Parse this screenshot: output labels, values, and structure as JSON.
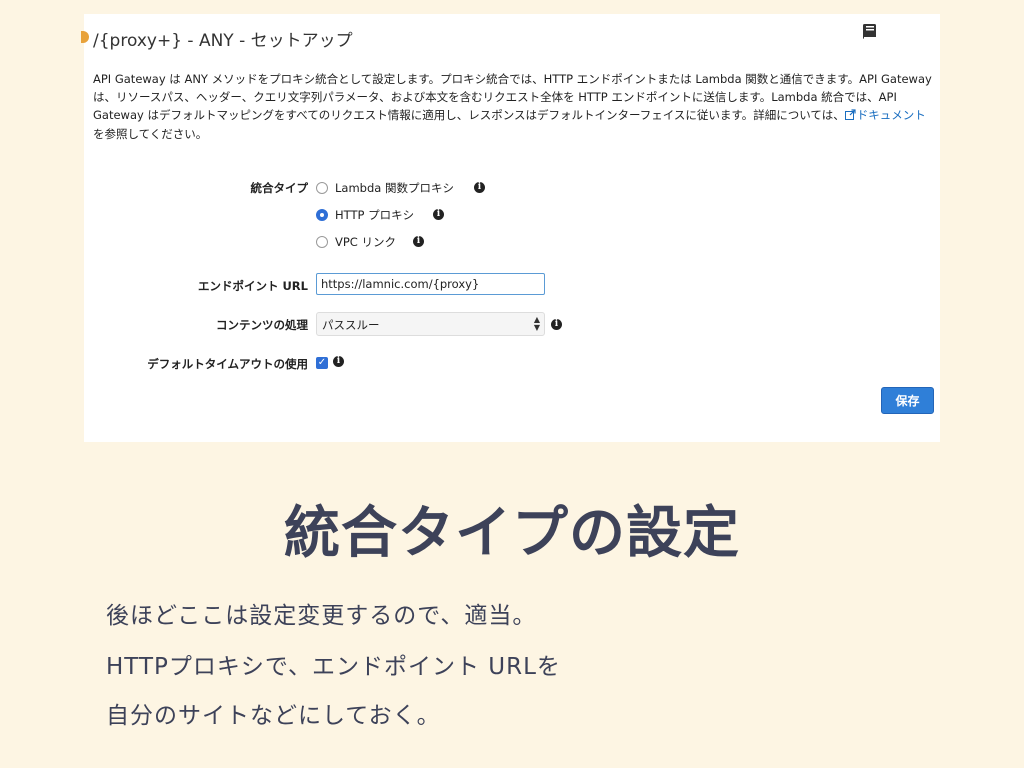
{
  "panel": {
    "title": "/{proxy+} - ANY - セットアップ",
    "icon": "book-icon",
    "description_part1": "API Gateway は ANY メソッドをプロキシ統合として設定します。プロキシ統合では、HTTP エンドポイントまたは Lambda 関数と通信できます。API Gateway は、リソースパス、ヘッダー、クエリ文字列パラメータ、および本文を含むリクエスト全体を HTTP エンドポイントに送信します。Lambda 統合では、API Gateway はデフォルトマッピングをすべてのリクエスト情報に適用し、レスポンスはデフォルトインターフェイスに従います。詳細については、",
    "description_link": "ドキュメント",
    "description_part2": "を参照してください。"
  },
  "form": {
    "integration_type_label": "統合タイプ",
    "options": [
      {
        "label": "Lambda 関数プロキシ",
        "selected": false
      },
      {
        "label": "HTTP プロキシ",
        "selected": true
      },
      {
        "label": "VPC リンク",
        "selected": false
      }
    ],
    "endpoint_url_label": "エンドポイント URL",
    "endpoint_url_value": "https://lamnic.com/{proxy}",
    "content_handling_label": "コンテンツの処理",
    "content_handling_value": "パススルー",
    "default_timeout_label": "デフォルトタイムアウトの使用",
    "default_timeout_checked": true,
    "save_label": "保存"
  },
  "slide": {
    "heading": "統合タイプの設定",
    "lines": [
      "後ほどここは設定変更するので、適当。",
      "HTTPプロキシで、エンドポイント URLを",
      "自分のサイトなどにしておく。"
    ]
  },
  "colors": {
    "background": "#fdf5e3",
    "accent_blue": "#2f7fd8",
    "heading": "#3d4259"
  }
}
